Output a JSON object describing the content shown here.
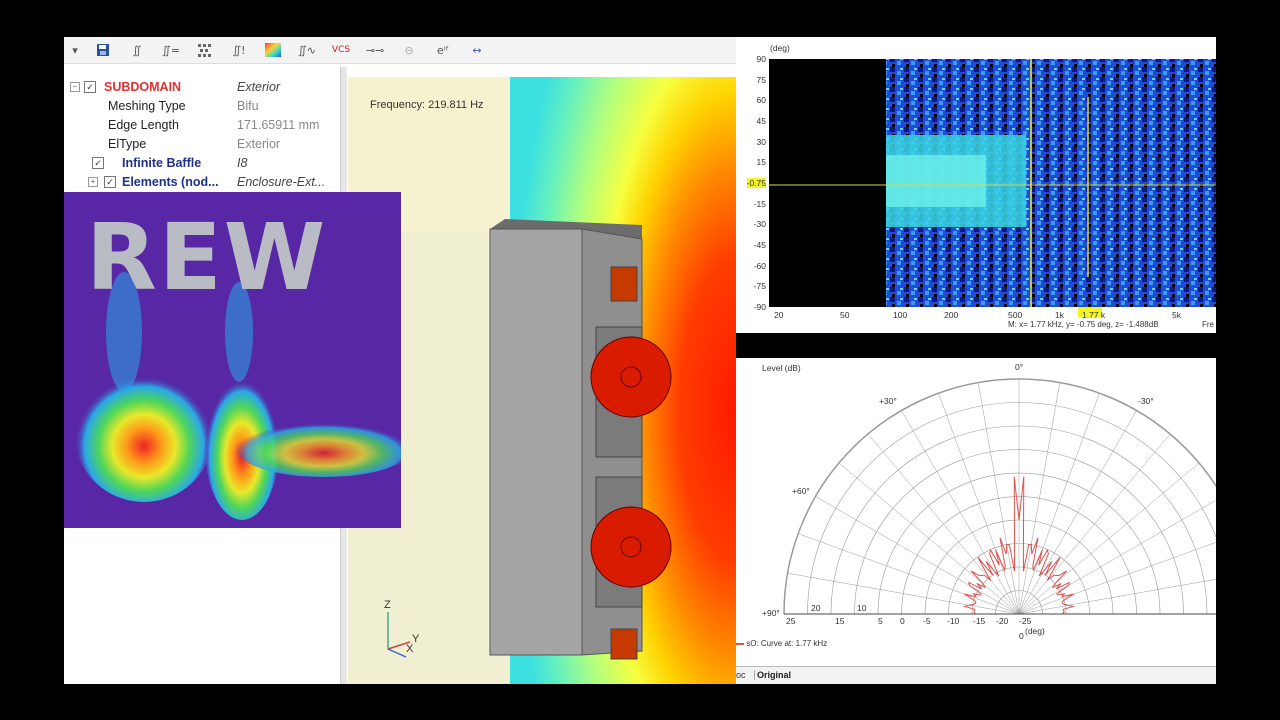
{
  "toolbar": {
    "icons": [
      "dropdown-icon",
      "save-icon",
      "integral-icon",
      "integral-equals-icon",
      "mesh-icon",
      "integral-bars-icon",
      "gradient-icon",
      "integral-plot-icon",
      "vcs-icon",
      "balance-icon",
      "circle-arrow-icon",
      "exp-icon",
      "swap-arrow-icon"
    ],
    "vcs_label": "VCS",
    "exp_label": "eⁱᶠ"
  },
  "tree": {
    "rows": [
      {
        "key": "SUBDOMAIN",
        "value": "Exterior"
      },
      {
        "key": "Meshing Type",
        "value": "Bifu"
      },
      {
        "key": "Edge Length",
        "value": "171.65911 mm"
      },
      {
        "key": "ElType",
        "value": "Exterior"
      },
      {
        "key": "Infinite Baffle",
        "value": "I8"
      },
      {
        "key": "Elements (nod...",
        "value": "Enclosure-Ext..."
      }
    ]
  },
  "viewport": {
    "frequency_label": "Frequency: 219.811 Hz",
    "axis_z": "Z",
    "axis_x": "X",
    "axis_y": "Y"
  },
  "rew": {
    "title": "REW"
  },
  "contour": {
    "y_unit": "(deg)",
    "y_ticks": [
      "90",
      "75",
      "60",
      "45",
      "30",
      "15",
      "-0.75",
      "-15",
      "-30",
      "-45",
      "-60",
      "-75",
      "-90"
    ],
    "x_ticks": [
      "20",
      "50",
      "100",
      "200",
      "500",
      "1k",
      "1.77 k",
      "5k"
    ],
    "marker_y_label": "-0.75",
    "marker_x_label": "1.77 k",
    "readout": "M:  x= 1.77 kHz,  y= -0.75 deg, z= -1.488dB",
    "readout_right": "Fre"
  },
  "polar": {
    "level_label": "Level  (dB)",
    "angle_labels": [
      "0°",
      "+30°",
      "-30°",
      "+60°",
      "+90°"
    ],
    "radial_ticks": [
      "25",
      "20",
      "15",
      "10",
      "5",
      "0",
      "-5",
      "-10",
      "-15",
      "-20",
      "-25"
    ],
    "angle_unit": "(deg)",
    "angle_zero": "0",
    "legend": "sO: Curve at: 1.77 kHz",
    "tabs": [
      "oc",
      "Original"
    ],
    "colors": {
      "curve": "#d9534f",
      "grid": "#9a9a9a"
    }
  }
}
